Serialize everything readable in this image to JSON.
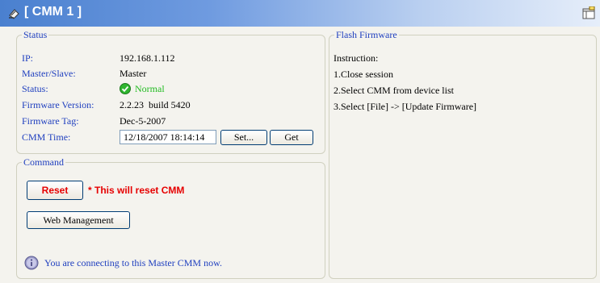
{
  "window": {
    "title": "[ CMM 1 ]",
    "accent_color": "#4a80cf"
  },
  "status": {
    "legend": "Status",
    "ip_label": "IP:",
    "ip_value": "192.168.1.112",
    "role_label": "Master/Slave:",
    "role_value": "Master",
    "status_label": "Status:",
    "status_value": "Normal",
    "status_color": "#22bb22",
    "fw_version_label": "Firmware Version:",
    "fw_version_value": "2.2.23  build 5420",
    "fw_tag_label": "Firmware Tag:",
    "fw_tag_value": "Dec-5-2007",
    "time_label": "CMM Time:",
    "time_value": "12/18/2007 18:14:14",
    "set_label": "Set...",
    "get_label": "Get"
  },
  "command": {
    "legend": "Command",
    "reset_label": "Reset",
    "reset_warning": "* This will reset CMM",
    "web_label": "Web Management",
    "info_text": "You are connecting to this Master CMM now."
  },
  "flash": {
    "legend": "Flash Firmware",
    "instructions": [
      "Instruction:",
      "1.Close session",
      "2.Select CMM from device list",
      "3.Select [File] -> [Update Firmware]"
    ]
  }
}
